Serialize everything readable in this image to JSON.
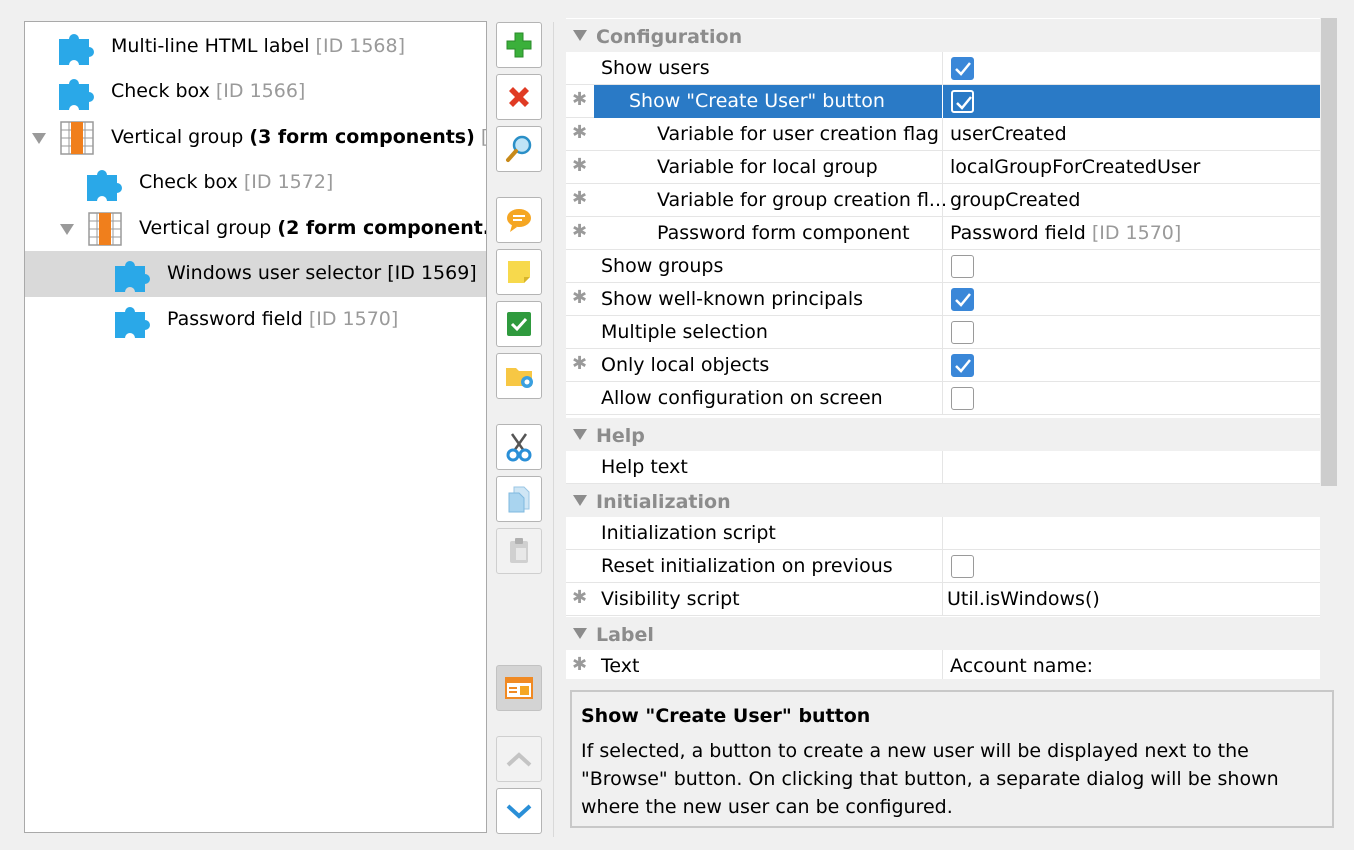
{
  "tree": {
    "items": [
      {
        "label": "Multi-line HTML label",
        "suffix": "[ID 1568]",
        "icon": "puzzle-icon",
        "expandable": false
      },
      {
        "label": "Check box",
        "suffix": "[ID 1566]",
        "icon": "puzzle-icon",
        "expandable": false
      },
      {
        "label": "Vertical group",
        "bold": "(3 form components)",
        "suffix": "[...",
        "icon": "vertical-group-icon",
        "expandable": true
      },
      {
        "label": "Check box",
        "suffix": "[ID 1572]",
        "icon": "puzzle-icon",
        "expandable": false
      },
      {
        "label": "Vertical group",
        "bold": "(2 form component...",
        "icon": "vertical-group-icon",
        "expandable": true
      },
      {
        "label": "Windows user selector [ID 1569]",
        "icon": "puzzle-icon",
        "selected": true
      },
      {
        "label": "Password field",
        "suffix": "[ID 1570]",
        "icon": "puzzle-icon"
      }
    ]
  },
  "toolbar": {
    "buttons": [
      "add-icon",
      "delete-icon",
      "magnifier-icon",
      "comment-icon",
      "note-icon",
      "check-icon",
      "folder-settings-icon",
      "scissors-icon",
      "copy-icon",
      "paste-icon",
      "layout-icon",
      "move-up-icon",
      "move-down-icon"
    ]
  },
  "properties": {
    "categories": [
      {
        "name": "Configuration",
        "rows": [
          {
            "name": "Show users",
            "checked": true
          },
          {
            "name": "Show \"Create User\" button",
            "checked": true,
            "modified": true,
            "selected": true
          },
          {
            "name": "Variable for user creation flag",
            "value": "userCreated",
            "modified": true
          },
          {
            "name": "Variable for local group",
            "value": "localGroupForCreatedUser",
            "modified": true
          },
          {
            "name": "Variable for group creation fl...",
            "value": "groupCreated",
            "modified": true
          },
          {
            "name": "Password form component",
            "value": "Password field",
            "value_suffix": "[ID 1570]",
            "modified": true
          },
          {
            "name": "Show groups",
            "checked": false
          },
          {
            "name": "Show well-known principals",
            "checked": true,
            "modified": true
          },
          {
            "name": "Multiple selection",
            "checked": false
          },
          {
            "name": "Only local objects",
            "checked": true,
            "modified": true
          },
          {
            "name": "Allow configuration on screen",
            "checked": false
          }
        ]
      },
      {
        "name": "Help",
        "rows": [
          {
            "name": "Help text",
            "value": ""
          }
        ]
      },
      {
        "name": "Initialization",
        "rows": [
          {
            "name": "Initialization script",
            "value": ""
          },
          {
            "name": "Reset initialization on previous",
            "checked": false
          },
          {
            "name": "Visibility script",
            "value": "Util.isWindows()",
            "modified": true
          }
        ]
      },
      {
        "name": "Label",
        "rows": [
          {
            "name": "Text",
            "value": "Account name:",
            "modified": true
          }
        ]
      }
    ]
  },
  "help": {
    "title": "Show \"Create User\" button",
    "body": "If selected, a button to create a new user will be displayed next to the \"Browse\" button. On clicking that button, a separate dialog will be shown where the new user can be configured."
  },
  "colors": {
    "selection": "#2a7ac6",
    "checkbox_checked": "#3a87d8",
    "muted_text": "#9a9a9a",
    "category_text": "#8c8c8c"
  }
}
